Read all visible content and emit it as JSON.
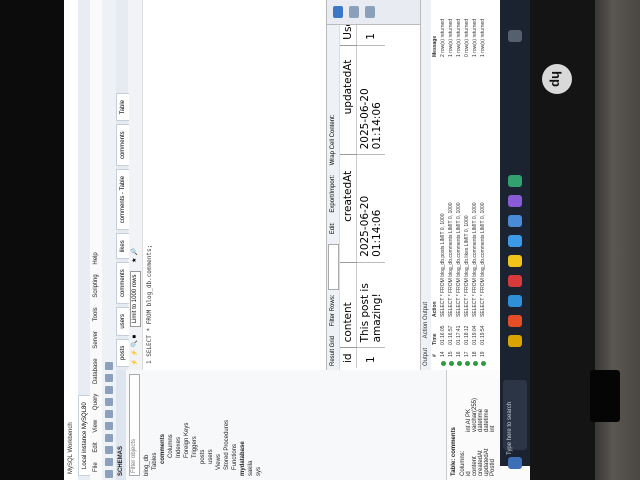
{
  "app": {
    "title": "MySQL Workbench",
    "instance_tab": "Local instance MySQL80",
    "menu": [
      "File",
      "Edit",
      "View",
      "Query",
      "Database",
      "Server",
      "Tools",
      "Scripting",
      "Help"
    ]
  },
  "navigator": {
    "header": "SCHEMAS",
    "filter_placeholder": "Filter objects",
    "items": [
      "blog_db",
      "Tables",
      "comments",
      "Columns",
      "Indexes",
      "Foreign Keys",
      "Triggers",
      "posts",
      "users",
      "Views",
      "Stored Procedures",
      "Functions",
      "mydatabase",
      "sakila",
      "sys"
    ],
    "info_title": "Table: comments",
    "info_cols": [
      "Columns:",
      "id",
      "content",
      "createdAt",
      "updatedAt",
      "PostId"
    ],
    "info_types": [
      "int AI PK",
      "varchar(255)",
      "datetime",
      "datetime",
      "int"
    ]
  },
  "editor": {
    "tabs": [
      "posts",
      "users",
      "comments",
      "likes",
      "comments - Table",
      "comments",
      "Table"
    ],
    "limit_label": "Limit to 1000 rows",
    "sql": "1   SELECT * FROM blog_db.comments;"
  },
  "results": {
    "toolbar_label": "Result Grid",
    "filter_label": "Filter Rows:",
    "edit_label": "Edit:",
    "export_label": "Export/Import:",
    "wrap_label": "Wrap Cell Content:",
    "columns": [
      "id",
      "content",
      "createdAt",
      "updatedAt",
      "UserId"
    ],
    "rows": [
      [
        "1",
        "This post is amazing!",
        "2025-06-20 01:14:06",
        "2025-06-20 01:14:06",
        "1"
      ]
    ],
    "side_labels": [
      "Result Grid",
      "Form Editor",
      "Field Types"
    ]
  },
  "output": {
    "header": "Output",
    "mode": "Action Output",
    "columns": [
      "#",
      "Time",
      "Action",
      "Message"
    ],
    "rows": [
      {
        "n": "14",
        "time": "01:16:05",
        "action": "SELECT * FROM blog_db.posts LIMIT 0, 1000",
        "msg": "2 row(s) returned"
      },
      {
        "n": "15",
        "time": "01:16:57",
        "action": "SELECT * FROM blog_db.comments LIMIT 0, 1000",
        "msg": "1 row(s) returned"
      },
      {
        "n": "16",
        "time": "01:17:41",
        "action": "SELECT * FROM blog_db.comments LIMIT 0, 1000",
        "msg": "1 row(s) returned"
      },
      {
        "n": "17",
        "time": "01:18:12",
        "action": "SELECT * FROM blog_db.likes LIMIT 0, 1000",
        "msg": "0 row(s) returned"
      },
      {
        "n": "18",
        "time": "01:19:04",
        "action": "SELECT * FROM blog_db.comments LIMIT 0, 1000",
        "msg": "1 row(s) returned"
      },
      {
        "n": "19",
        "time": "01:19:54",
        "action": "SELECT * FROM blog_db.comments LIMIT 0, 1000",
        "msg": "1 row(s) returned"
      }
    ]
  },
  "taskbar": {
    "search_placeholder": "Type here to search"
  },
  "colors": {
    "accent": "#3a78c9",
    "ok": "#2e9b3e",
    "taskbar": "#1b2330"
  }
}
